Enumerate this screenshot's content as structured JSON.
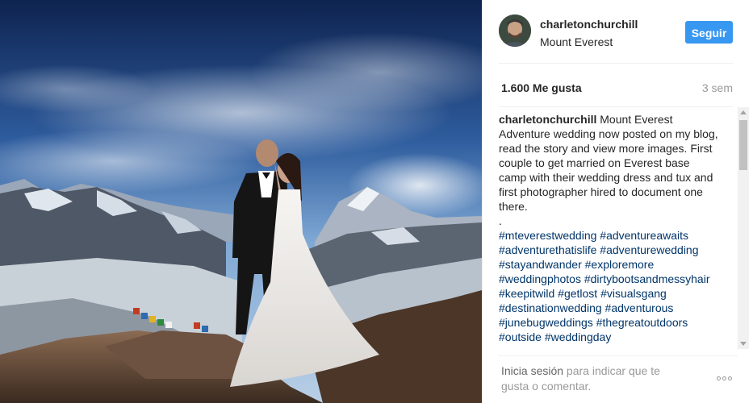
{
  "post": {
    "photo_alt": "Couple in wedding attire on Everest base camp rock with mountains and glacier behind",
    "user": {
      "username": "charletonchurchill",
      "location": "Mount Everest"
    },
    "follow_label": "Seguir",
    "likes": "1.600 Me gusta",
    "time_ago": "3 sem",
    "caption": {
      "username": "charletonchurchill",
      "text": "Mount Everest Adventure wedding now posted on my blog, read the story and view more images. First couple to get married on Everest base camp with their wedding dress and tux and first photographer hired to document one there.",
      "separator": ".",
      "hashtags": "#mteverestwedding #adventureawaits #adventurethatislife #adventurewedding #stayandwander #exploremore #weddingphotos #dirtybootsandmessyhair #keepitwild #getlost #visualsgang #destinationwedding #adventurous #junebugweddings #thegreatoutdoors #outside #weddingday"
    },
    "footer": {
      "login_link": "Inicia sesión",
      "login_suffix": " para indicar que te gusta o comentar."
    }
  },
  "colors": {
    "accent": "#3897f0",
    "hashtag": "#003569",
    "muted": "#999999"
  }
}
